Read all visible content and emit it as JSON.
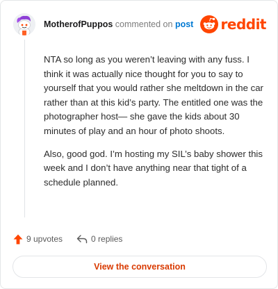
{
  "header": {
    "username": "MotherofPuppos",
    "action": "commented on",
    "target": "post",
    "brand": "reddit",
    "brand_color": "#ff4500",
    "avatar_icon": "snoo-avatar-purple-hair"
  },
  "comment": {
    "paragraphs": [
      "NTA so long as you weren’t leaving with any fuss. I think it was actually nice thought for you to say to yourself that you would rather she meltdown in the car rather than at this kid’s party. The entitled one was the photographer host— she gave the kids about 30 minutes of play and an hour of photo shoots.",
      "Also, good god. I’m hosting my SIL’s baby shower this week and I don’t have anything near that tight of a schedule planned."
    ]
  },
  "stats": {
    "upvotes": "9 upvotes",
    "upvote_icon": "upvote-arrow-icon",
    "upvote_color": "#ff4500",
    "replies": "0 replies",
    "reply_icon": "reply-arrow-icon"
  },
  "cta": {
    "label": "View the conversation",
    "color": "#d93a00"
  }
}
